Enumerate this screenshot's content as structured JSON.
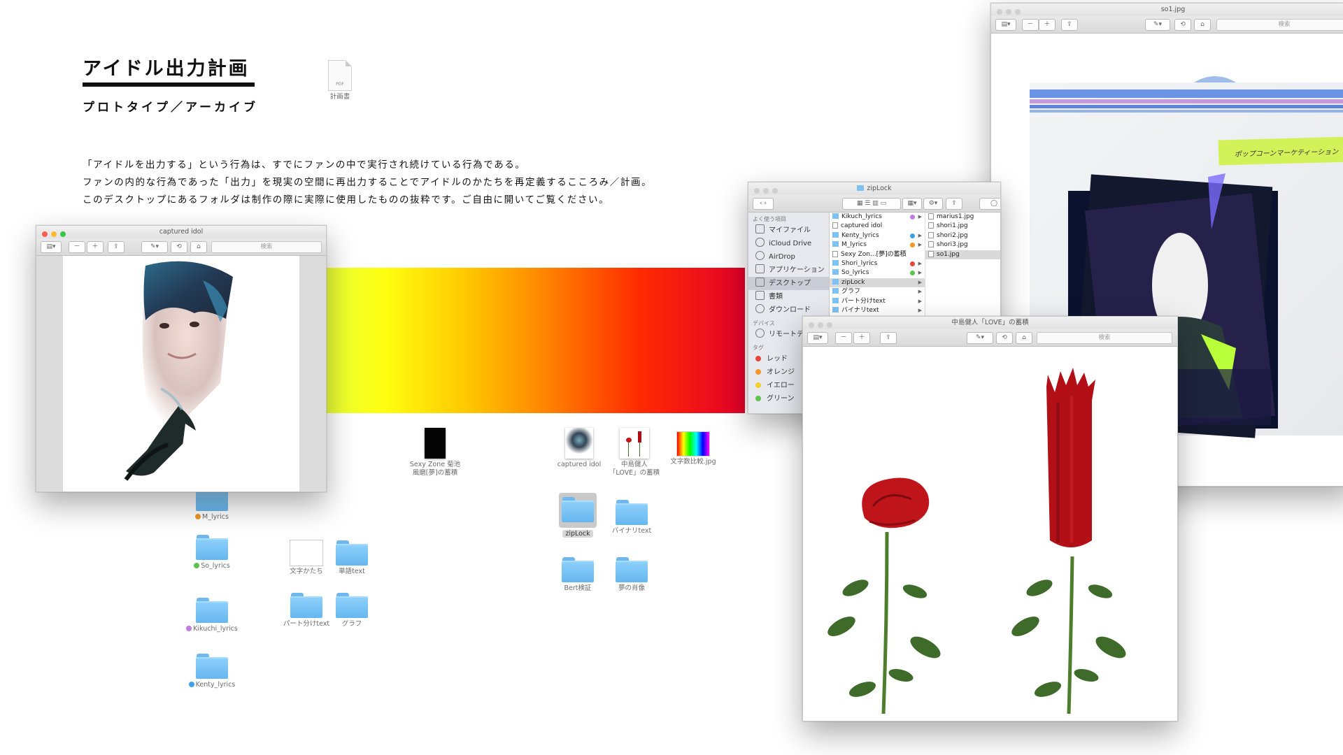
{
  "heading": {
    "title": "アイドル出力計画",
    "subtitle": "プロトタイプ／アーカイブ",
    "description": [
      "「アイドルを出力する」という行為は、すでにファンの中で実行され続けている行為である。",
      "ファンの内的な行為であった「出力」を現実の空間に再出力することでアイドルのかたちを再定義するこころみ／計画。",
      "このデスクトップにあるフォルダは制作の際に実際に使用したものの抜粋です。ご自由に開いてご覧ください。"
    ]
  },
  "desktop": {
    "pdf": {
      "label": "計画書",
      "badge": "PDF"
    },
    "files": [
      {
        "label": "Sexy Zone 菊池風磨の蓄積",
        "lines": [
          "Sexy Zone 菊池",
          "風磨[夢]の蓄積"
        ]
      },
      {
        "label": "captured idol",
        "lines": [
          "captured idol"
        ]
      },
      {
        "label": "中島健人「LOVE」の蓄積",
        "lines": [
          "中島健人",
          "「LOVE」の蓄積"
        ]
      },
      {
        "label": "文字数比較.jpg",
        "lines": [
          "文字数比較.jpg"
        ]
      }
    ],
    "folders": [
      {
        "label": "M_lyrics",
        "tag_color": "#f0962a"
      },
      {
        "label": "So_lyrics",
        "tag_color": "#5ec24e"
      },
      {
        "label": "Kikuchi_lyrics",
        "tag_color": "#c27be0"
      },
      {
        "label": "Kenty_lyrics",
        "tag_color": "#3f9ee8"
      },
      {
        "label": "文字かたち"
      },
      {
        "label": "単語text"
      },
      {
        "label": "パート分けtext"
      },
      {
        "label": "グラフ"
      },
      {
        "label": "zipLock"
      },
      {
        "label": "バイナリtext"
      },
      {
        "label": "Bert検証"
      },
      {
        "label": "夢の肖像"
      }
    ]
  },
  "windows": {
    "captured": {
      "title": "captured idol",
      "search_placeholder": "検索",
      "colors": {
        "tint": "#3a90c0"
      }
    },
    "so1": {
      "title": "so1.jpg",
      "search_placeholder": "検索",
      "sticky_note": "ポップコーンマーケティーション"
    },
    "finder": {
      "title": "zipLock",
      "sidebar": {
        "favorites_header": "よく使う項目",
        "favorites": [
          {
            "label": "マイファイル",
            "icon": "files-icon"
          },
          {
            "label": "iCloud Drive",
            "icon": "cloud-icon"
          },
          {
            "label": "AirDrop",
            "icon": "airdrop-icon"
          },
          {
            "label": "アプリケーション",
            "icon": "apps-icon"
          },
          {
            "label": "デスクトップ",
            "icon": "desktop-icon",
            "selected": true
          },
          {
            "label": "書類",
            "icon": "documents-icon"
          },
          {
            "label": "ダウンロード",
            "icon": "download-icon"
          }
        ],
        "devices_header": "デバイス",
        "devices": [
          {
            "label": "リモートディスク",
            "icon": "disc-icon"
          }
        ],
        "tags_header": "タグ",
        "tags": [
          {
            "label": "レッド",
            "color": "#e8453c"
          },
          {
            "label": "オレンジ",
            "color": "#f0962a"
          },
          {
            "label": "イエロー",
            "color": "#f2cf2b"
          },
          {
            "label": "グリーン",
            "color": "#5ec24e"
          }
        ]
      },
      "column1": [
        {
          "label": "Kikuch_lyrics",
          "kind": "folder",
          "tag": "#c27be0"
        },
        {
          "label": "captured idol",
          "kind": "file"
        },
        {
          "label": "Kenty_lyrics",
          "kind": "folder",
          "tag": "#3f9ee8"
        },
        {
          "label": "M_lyrics",
          "kind": "folder",
          "tag": "#f0962a"
        },
        {
          "label": "Sexy Zon...[夢]の蓄積",
          "kind": "file"
        },
        {
          "label": "Shori_lyrics",
          "kind": "folder",
          "tag": "#e8453c"
        },
        {
          "label": "So_lyrics",
          "kind": "folder",
          "tag": "#5ec24e"
        },
        {
          "label": "zipLock",
          "kind": "folder",
          "selected": true
        },
        {
          "label": "グラフ",
          "kind": "folder"
        },
        {
          "label": "パート分けtext",
          "kind": "folder"
        },
        {
          "label": "バイナリtext",
          "kind": "folder"
        }
      ],
      "column2": [
        {
          "label": "marius1.jpg"
        },
        {
          "label": "shori1.jpg"
        },
        {
          "label": "shori2.jpg"
        },
        {
          "label": "shori3.jpg"
        },
        {
          "label": "so1.jpg",
          "selected": true
        }
      ]
    },
    "love": {
      "title": "中島健人「LOVE」の蓄積",
      "search_placeholder": "検索"
    }
  }
}
